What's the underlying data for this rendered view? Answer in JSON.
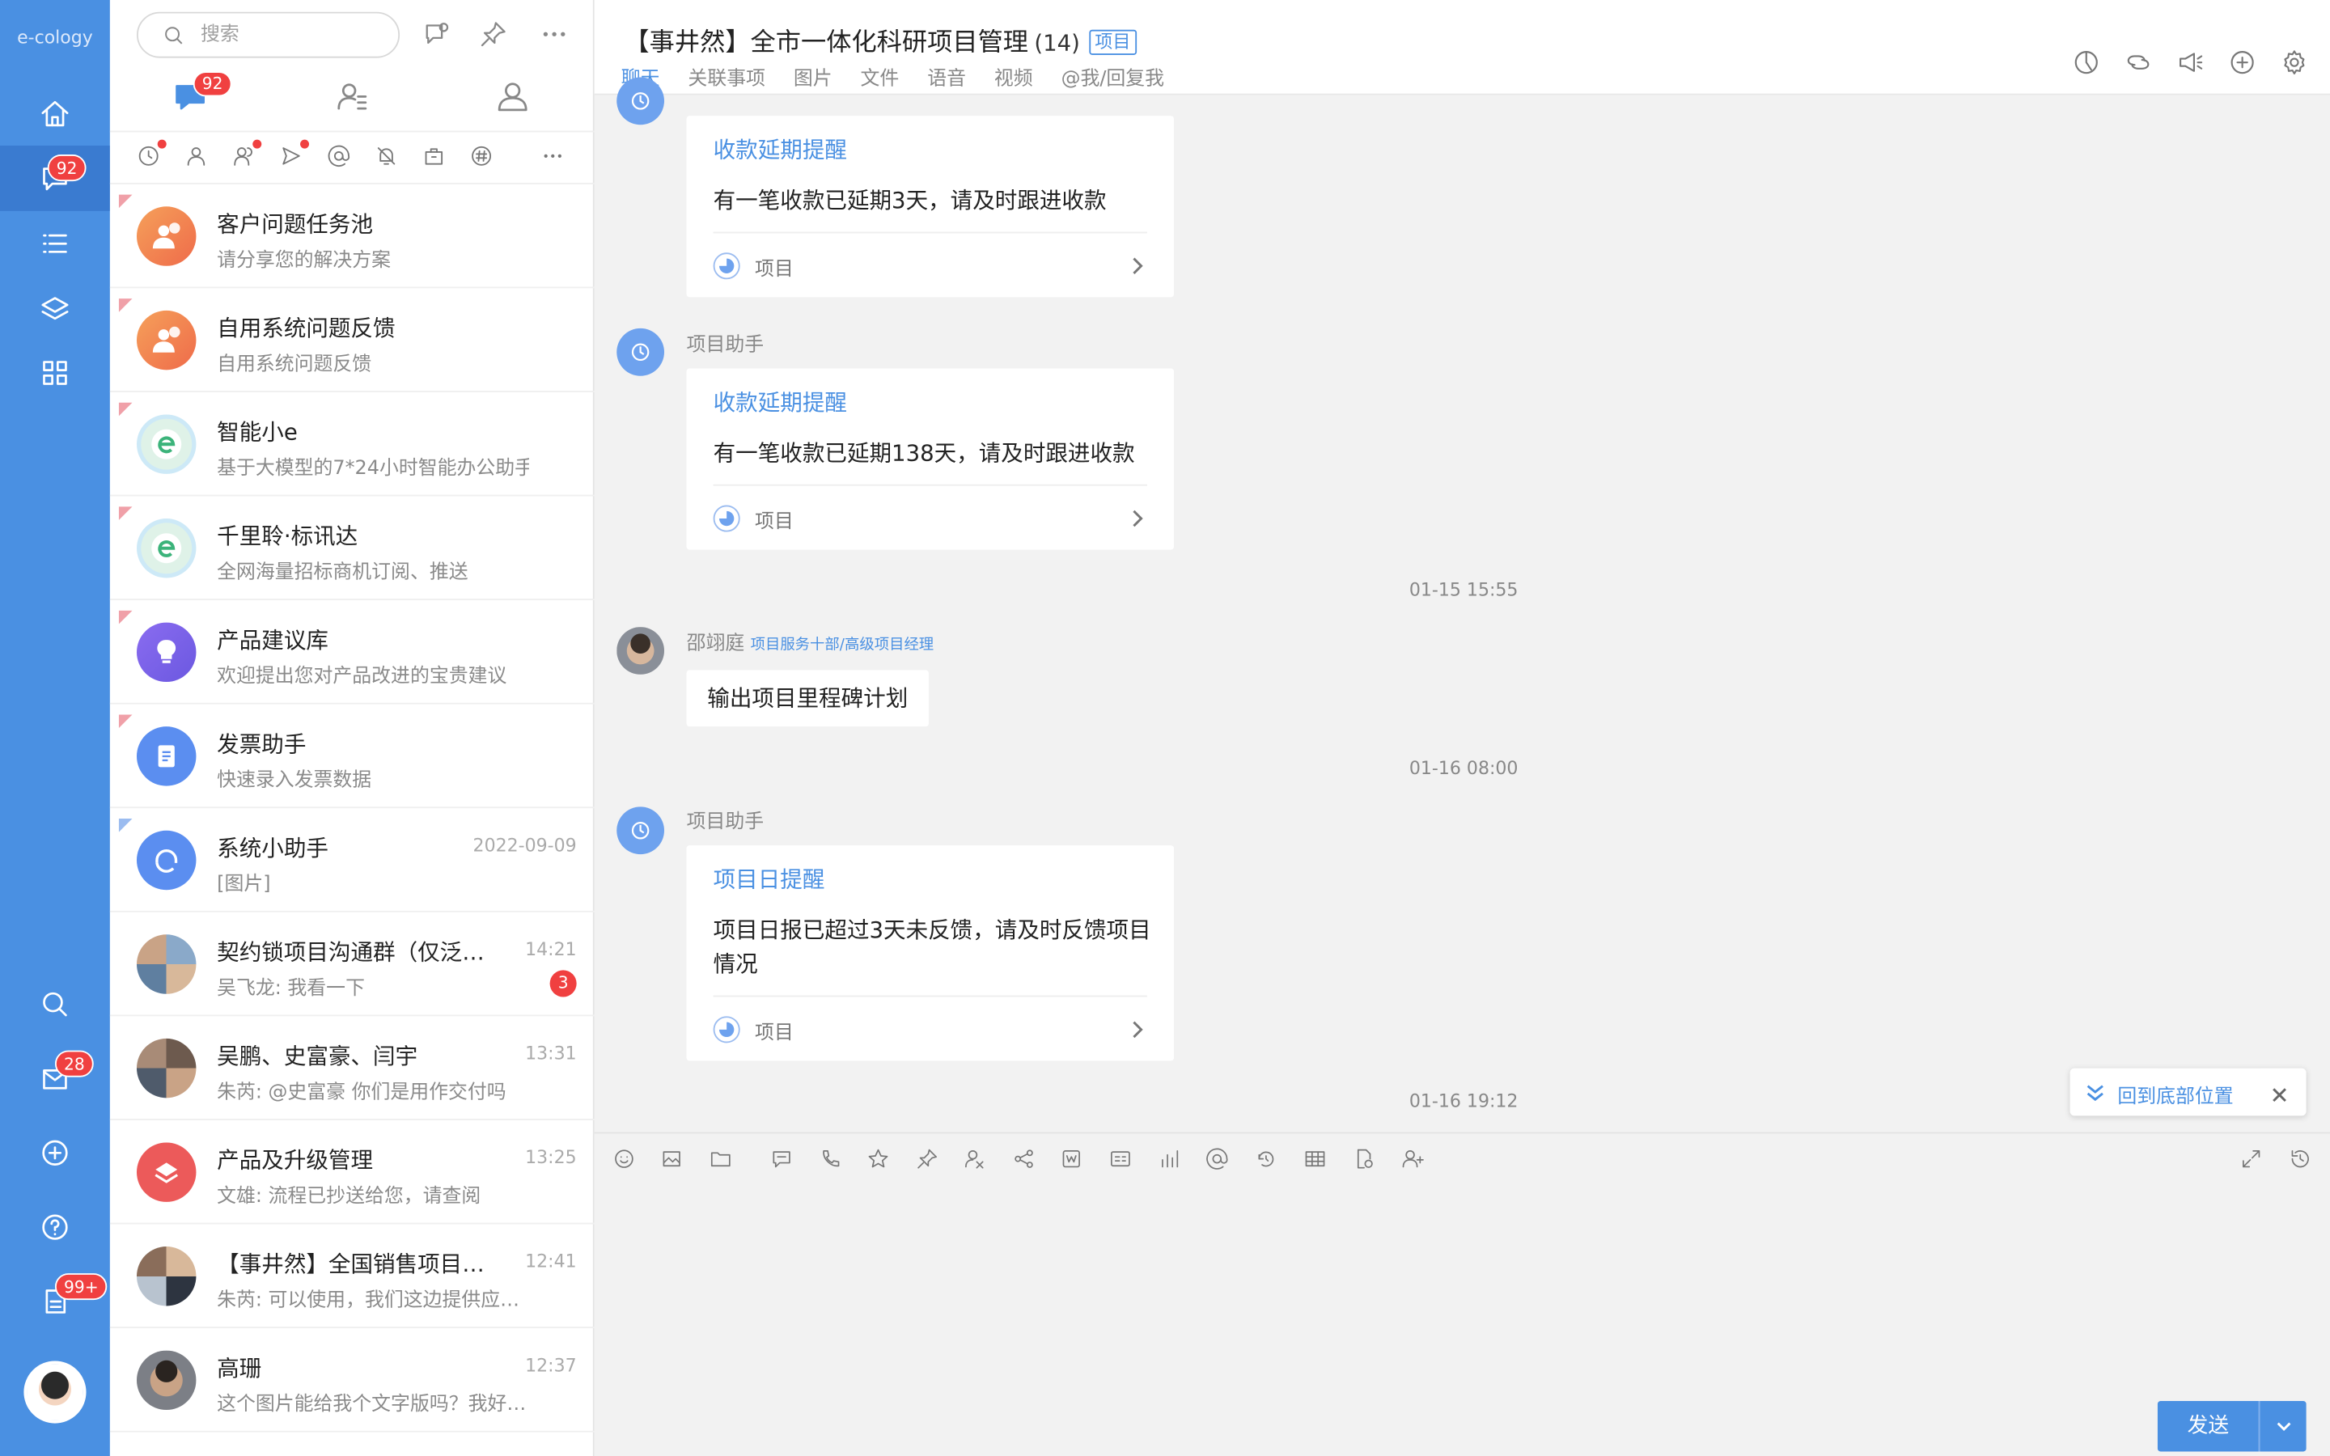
{
  "app": {
    "logo": "e-cology"
  },
  "nav": {
    "messages_badge": "92",
    "mail_badge": "28",
    "docs_badge": "99+"
  },
  "list": {
    "search_placeholder": "搜索",
    "chat_tab_badge": "92",
    "conversations": [
      {
        "name": "客户问题任务池",
        "sub": "请分享您的解决方案",
        "time": "",
        "badge": ""
      },
      {
        "name": "自用系统问题反馈",
        "sub": "自用系统问题反馈",
        "time": "",
        "badge": ""
      },
      {
        "name": "智能小e",
        "sub": "基于大模型的7*24小时智能办公助手",
        "time": "",
        "badge": ""
      },
      {
        "name": "千里聆·标讯达",
        "sub": "全网海量招标商机订阅、推送",
        "time": "",
        "badge": ""
      },
      {
        "name": "产品建议库",
        "sub": "欢迎提出您对产品改进的宝贵建议",
        "time": "",
        "badge": ""
      },
      {
        "name": "发票助手",
        "sub": "快速录入发票数据",
        "time": "",
        "badge": ""
      },
      {
        "name": "系统小助手",
        "sub": "[图片]",
        "time": "2022-09-09",
        "badge": ""
      },
      {
        "name": "契约锁项目沟通群（仅泛…",
        "sub": "吴飞龙: 我看一下",
        "time": "14:21",
        "badge": "3"
      },
      {
        "name": "吴鹏、史富豪、闫宇",
        "sub": "朱芮: @史富豪  你们是用作交付吗",
        "time": "13:31",
        "badge": ""
      },
      {
        "name": "产品及升级管理",
        "sub": "文雄: 流程已抄送给您，请查阅",
        "time": "13:25",
        "badge": ""
      },
      {
        "name": "【事井然】全国销售项目…",
        "sub": "朱芮: 可以使用，我们这边提供应…",
        "time": "12:41",
        "badge": ""
      },
      {
        "name": "高珊",
        "sub": "这个图片能给我个文字版吗？我好…",
        "time": "12:37",
        "badge": ""
      }
    ]
  },
  "chat": {
    "title": "【事井然】全市一体化科研项目管理",
    "count": "(14)",
    "tag": "项目",
    "tabs": [
      "聊天",
      "关联事项",
      "图片",
      "文件",
      "语音",
      "视频",
      "@我/回复我"
    ],
    "messages": {
      "card1": {
        "title": "收款延期提醒",
        "body": "有一笔收款已延期3天，请及时跟进收款",
        "footer": "项目"
      },
      "sender2": "项目助手",
      "card2": {
        "title": "收款延期提醒",
        "body": "有一笔收款已延期138天，请及时跟进收款",
        "footer": "项目"
      },
      "time1": "01-15 15:55",
      "sender3": "邵翊庭",
      "sender3_role": "项目服务十部/高级项目经理",
      "bubble3": "输出项目里程碑计划",
      "time2": "01-16 08:00",
      "sender4": "项目助手",
      "card4": {
        "title": "项目日提醒",
        "body": "项目日报已超过3天未反馈，请及时反馈项目情况",
        "footer": "项目"
      },
      "time3": "01-16 19:12"
    },
    "back_to_bottom": "回到底部位置",
    "send_label": "发送"
  },
  "colors": {
    "accent": "#4a90e2",
    "badge": "#f04040",
    "nav_bg": "#4a90e2"
  }
}
